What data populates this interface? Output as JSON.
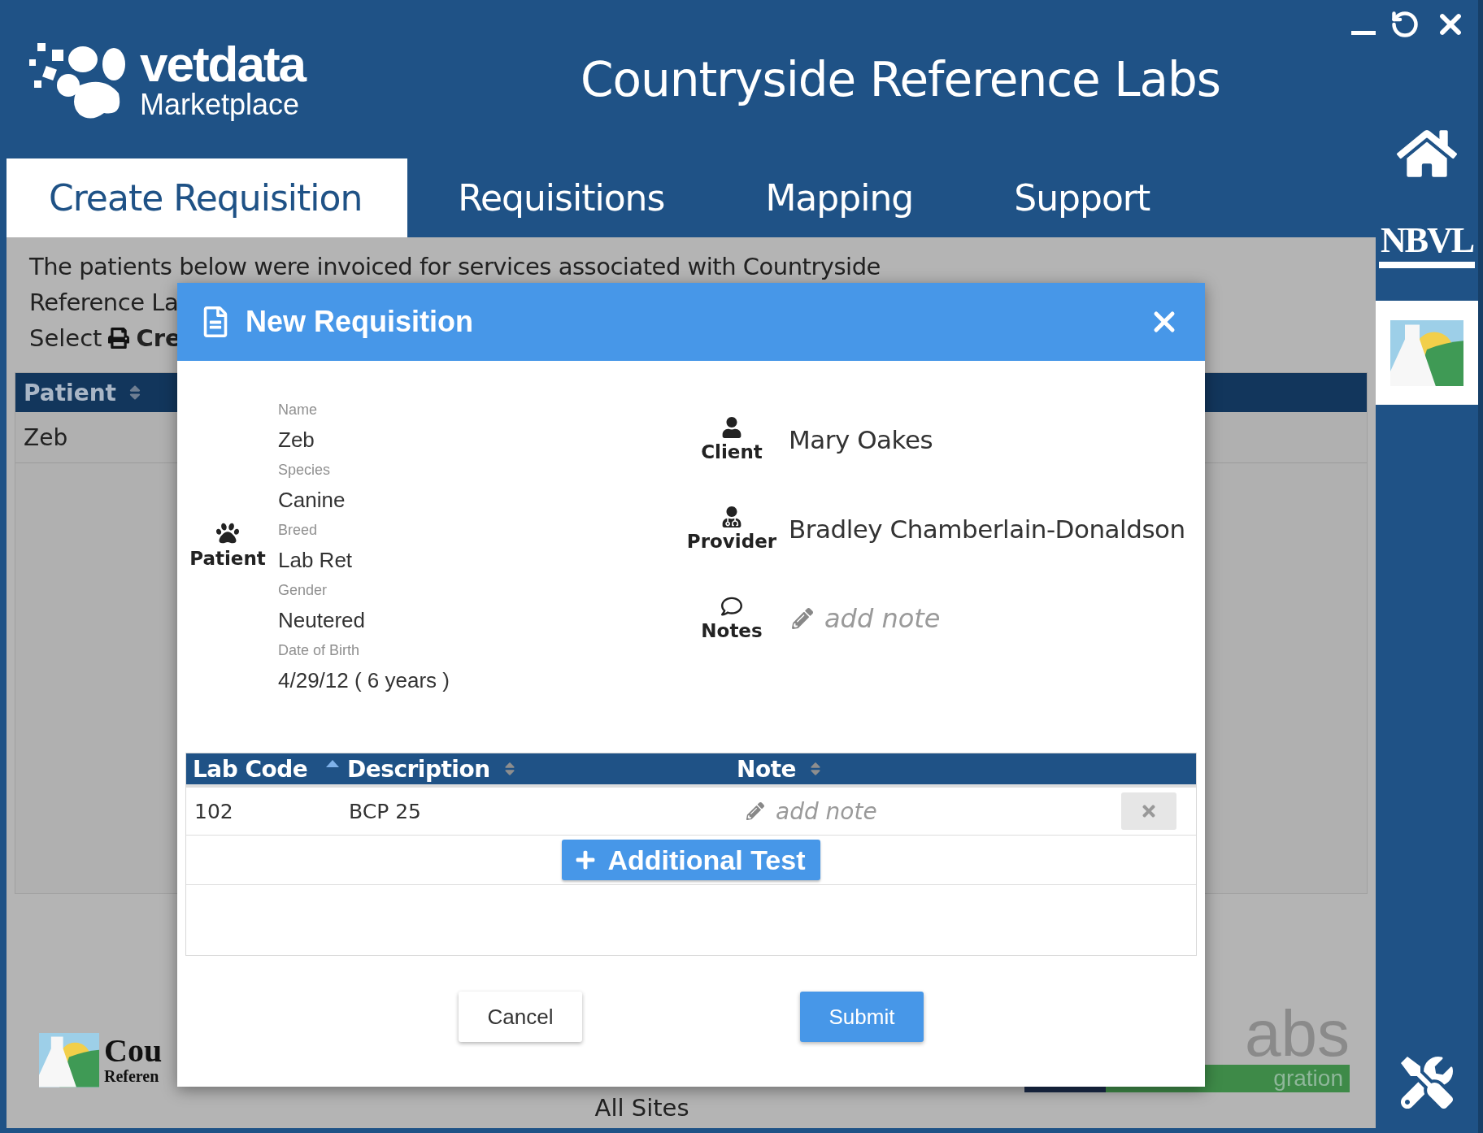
{
  "header": {
    "logo": {
      "name": "vetdata",
      "subtitle": "Marketplace"
    },
    "title": "Countryside Reference Labs"
  },
  "tabs": [
    {
      "label": "Create Requisition",
      "selected": true
    },
    {
      "label": "Requisitions",
      "selected": false
    },
    {
      "label": "Mapping",
      "selected": false
    },
    {
      "label": "Support",
      "selected": false
    }
  ],
  "sidebar": {
    "items": [
      {
        "kind": "home",
        "selected": false
      },
      {
        "kind": "nbvl",
        "label": "NBVL",
        "selected": false
      },
      {
        "kind": "lab",
        "selected": true
      },
      {
        "kind": "tools",
        "selected": false
      }
    ]
  },
  "background": {
    "intro_lines": [
      "The patients below were invoiced for services associated with Countryside",
      "Reference La"
    ],
    "select": {
      "text": "Select",
      "action": "Cre"
    },
    "table": {
      "columns": [
        "Patient"
      ],
      "rows": [
        "Zeb"
      ]
    },
    "footer_logo": {
      "line1": "Cou",
      "line2": "Referen"
    },
    "site": "All Sites",
    "integration_logo": {
      "line1": "abs",
      "line2": "gration"
    }
  },
  "dialog": {
    "title": "New Requisition",
    "patient": {
      "label": "Patient",
      "fields": [
        {
          "label": "Name",
          "value": "Zeb"
        },
        {
          "label": "Species",
          "value": "Canine"
        },
        {
          "label": "Breed",
          "value": "Lab Ret"
        },
        {
          "label": "Gender",
          "value": "Neutered"
        },
        {
          "label": "Date of Birth",
          "value": "4/29/12 ( 6 years  )"
        }
      ]
    },
    "contacts": [
      {
        "kind": "client",
        "label": "Client",
        "value": "Mary Oakes"
      },
      {
        "kind": "provider",
        "label": "Provider",
        "value": "Bradley Chamberlain-Donaldson"
      },
      {
        "kind": "notes",
        "label": "Notes",
        "placeholder": "add note"
      }
    ],
    "tests": {
      "columns": [
        {
          "label": "Lab Code",
          "sorted": true
        },
        {
          "label": "Description",
          "sorted": false
        },
        {
          "label": "Note",
          "sorted": false
        }
      ],
      "rows": [
        {
          "lab_code": "102",
          "description": "BCP 25",
          "placeholder": "add note"
        }
      ],
      "add_button": "Additional Test"
    },
    "buttons": [
      {
        "label": "Cancel",
        "kind": "secondary"
      },
      {
        "label": "Submit",
        "kind": "primary"
      }
    ]
  }
}
